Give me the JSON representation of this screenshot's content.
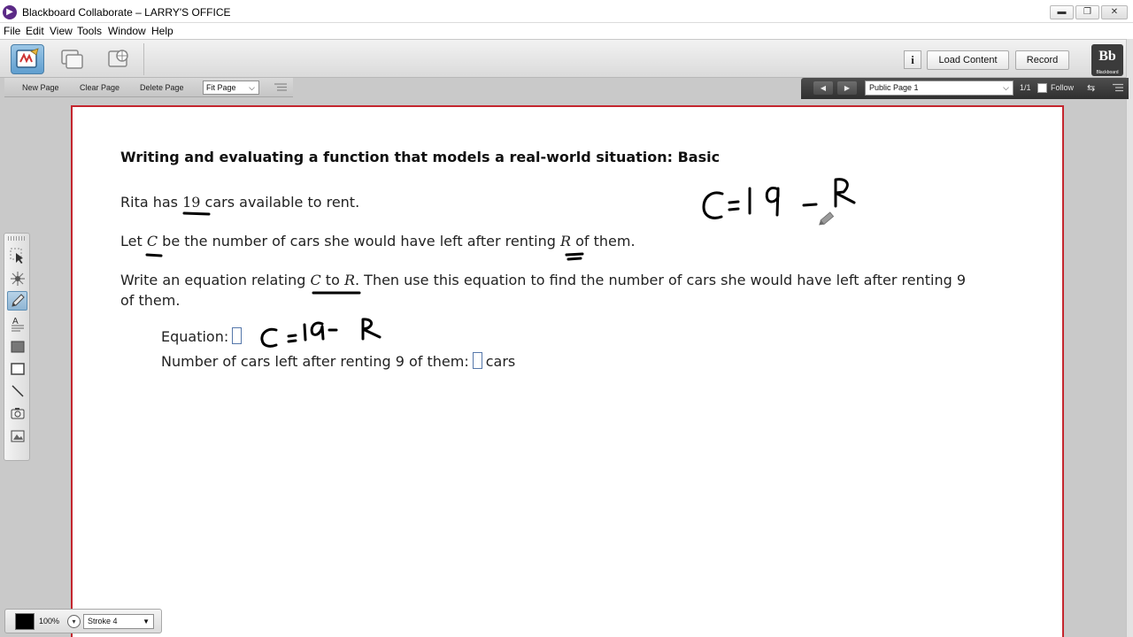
{
  "window": {
    "title": "Blackboard Collaborate – LARRY'S OFFICE",
    "min_glyph": "▬",
    "max_glyph": "❐",
    "close_glyph": "✕"
  },
  "menu": [
    "File",
    "Edit",
    "View",
    "Tools",
    "Window",
    "Help"
  ],
  "toolbar": {
    "info_label": "i",
    "load_content_label": "Load Content",
    "record_label": "Record",
    "logo_text": "Bb",
    "logo_caption": "Blackboard"
  },
  "subbar": {
    "new_page": "New Page",
    "clear_page": "Clear Page",
    "delete_page": "Delete Page",
    "zoom_value": "Fit Page"
  },
  "navbar": {
    "prev_glyph": "◀",
    "next_glyph": "▶",
    "page_value": "Public Page 1",
    "page_count": "1/1",
    "follow_label": "Follow",
    "arrows_glyph": "⇆"
  },
  "problem": {
    "heading": "Writing and evaluating a function that models a real-world situation: Basic",
    "line1_pre": "Rita has ",
    "line1_num": "19",
    "line1_post": " cars available to rent.",
    "line2_pre": "Let ",
    "line2_var1": "C",
    "line2_mid": " be the number of cars she would have left after renting ",
    "line2_var2": "R",
    "line2_post": " of them.",
    "line3_pre": "Write an equation relating ",
    "line3_var1": "C",
    "line3_to": " to ",
    "line3_var2": "R",
    "line3_post": ". Then use this equation to find the number of cars she would have left after renting 9",
    "line4": "of them.",
    "equation_label": "Equation:",
    "cars_left_label": "Number of cars left after renting 9 of them:",
    "cars_unit": "cars"
  },
  "stroke": {
    "color": "#000000",
    "opacity": "100%",
    "chev_glyph": "▾",
    "stroke_value": "Stroke 4"
  },
  "colors": {
    "page_border": "#c4262e",
    "ink": "#000000",
    "accent_tool": "#5f9ecf"
  }
}
